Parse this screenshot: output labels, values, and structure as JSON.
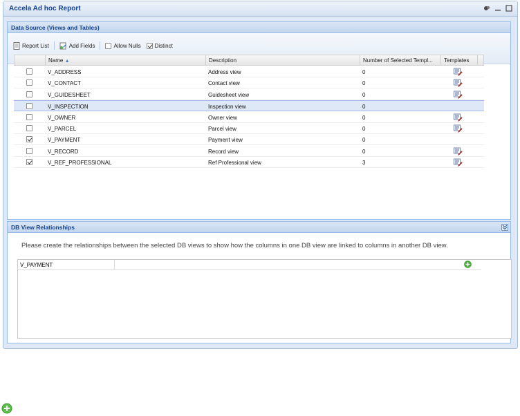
{
  "window": {
    "title": "Accela Ad hoc Report"
  },
  "data_source": {
    "title": "Data Source (Views and Tables)",
    "toolbar": {
      "report_list": "Report List",
      "add_fields": "Add Fields",
      "allow_nulls": "Allow Nulls",
      "distinct": "Distinct",
      "allow_nulls_checked": false,
      "distinct_checked": true
    },
    "columns": [
      "Name",
      "Description",
      "Number of Selected Templ...",
      "Templates"
    ],
    "sorted_column": "Name",
    "rows": [
      {
        "name": "V_ADDRESS",
        "description": "Address view",
        "count": "0",
        "checked": false,
        "template": true,
        "selected": false
      },
      {
        "name": "V_CONTACT",
        "description": "Contact view",
        "count": "0",
        "checked": false,
        "template": true,
        "selected": false
      },
      {
        "name": "V_GUIDESHEET",
        "description": "Guidesheet view",
        "count": "0",
        "checked": false,
        "template": true,
        "selected": false
      },
      {
        "name": "V_INSPECTION",
        "description": "Inspection view",
        "count": "0",
        "checked": false,
        "template": false,
        "selected": true
      },
      {
        "name": "V_OWNER",
        "description": "Owner view",
        "count": "0",
        "checked": false,
        "template": true,
        "selected": false
      },
      {
        "name": "V_PARCEL",
        "description": "Parcel view",
        "count": "0",
        "checked": false,
        "template": true,
        "selected": false
      },
      {
        "name": "V_PAYMENT",
        "description": "Payment view",
        "count": "0",
        "checked": true,
        "template": false,
        "selected": false
      },
      {
        "name": "V_RECORD",
        "description": "Record view",
        "count": "0",
        "checked": false,
        "template": true,
        "selected": false
      },
      {
        "name": "V_REF_PROFESSIONAL",
        "description": "Ref Professional view",
        "count": "3",
        "checked": true,
        "template": true,
        "selected": false
      }
    ]
  },
  "relationships": {
    "title": "DB View Relationships",
    "description": "Please create the relationships between the selected DB views to show how the columns in one DB view are linked to columns in another DB view.",
    "rows": [
      {
        "view": "V_PAYMENT"
      }
    ]
  },
  "colors": {
    "title": "#15428b",
    "panel_border": "#99bbe8",
    "selected_row": "#dfe8f6",
    "add_green": "#4caf3c"
  },
  "icons": [
    "restore-icon",
    "minimize-icon",
    "maximize-icon",
    "report-list-icon",
    "add-fields-icon",
    "template-edit-icon",
    "collapse-icon",
    "add-icon"
  ]
}
